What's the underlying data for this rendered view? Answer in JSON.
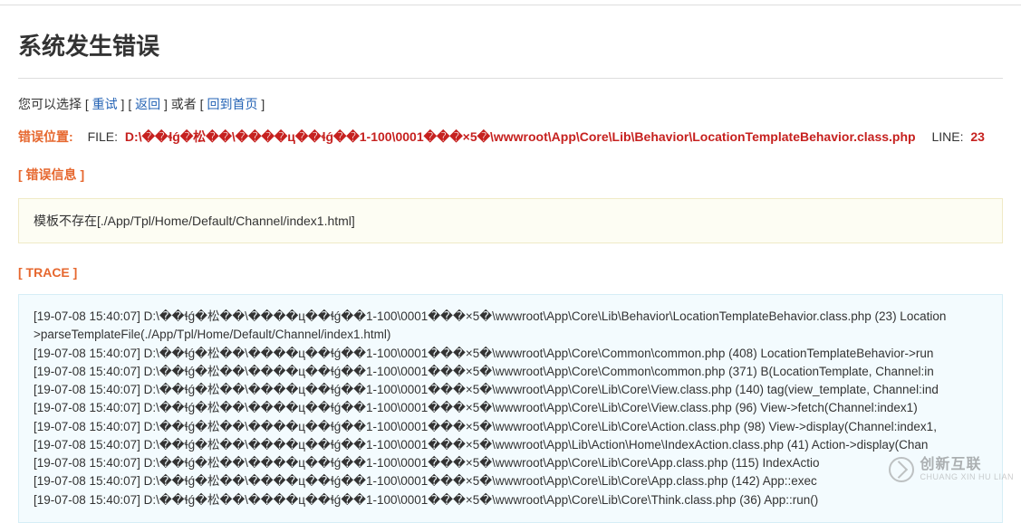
{
  "page_title": "系统发生错误",
  "options": {
    "prefix": "您可以选择",
    "retry_label": "重试",
    "back_label": "返回",
    "or_text": "或者",
    "home_label": "回到首页"
  },
  "error_location": {
    "label": "错误位置:",
    "file_label": "FILE:",
    "file_path": "D:\\��ɬǵ�松��\\����ц��ɬǵ��1-100\\0001���×5�\\wwwroot\\App\\Core\\Lib\\Behavior\\LocationTemplateBehavior.class.php",
    "line_label": "LINE:",
    "line_number": "23"
  },
  "error_info": {
    "header": "[ 错误信息 ]",
    "message": "模板不存在[./App/Tpl/Home/Default/Channel/index1.html]"
  },
  "trace": {
    "header": "[ TRACE ]",
    "lines": [
      "[19-07-08 15:40:07] D:\\��ɬǵ�松��\\����ц��ɬǵ��1-100\\0001���×5�\\wwwroot\\App\\Core\\Lib\\Behavior\\LocationTemplateBehavior.class.php (23) Location",
      ">parseTemplateFile(./App/Tpl/Home/Default/Channel/index1.html)",
      "[19-07-08 15:40:07] D:\\��ɬǵ�松��\\����ц��ɬǵ��1-100\\0001���×5�\\wwwroot\\App\\Core\\Common\\common.php (408) LocationTemplateBehavior->run",
      "[19-07-08 15:40:07] D:\\��ɬǵ�松��\\����ц��ɬǵ��1-100\\0001���×5�\\wwwroot\\App\\Core\\Common\\common.php (371) B(LocationTemplate, Channel:in",
      "[19-07-08 15:40:07] D:\\��ɬǵ�松��\\����ц��ɬǵ��1-100\\0001���×5�\\wwwroot\\App\\Core\\Lib\\Core\\View.class.php (140) tag(view_template, Channel:ind",
      "[19-07-08 15:40:07] D:\\��ɬǵ�松��\\����ц��ɬǵ��1-100\\0001���×5�\\wwwroot\\App\\Core\\Lib\\Core\\View.class.php (96) View->fetch(Channel:index1)",
      "[19-07-08 15:40:07] D:\\��ɬǵ�松��\\����ц��ɬǵ��1-100\\0001���×5�\\wwwroot\\App\\Core\\Lib\\Core\\Action.class.php (98) View->display(Channel:index1,",
      "[19-07-08 15:40:07] D:\\��ɬǵ�松��\\����ц��ɬǵ��1-100\\0001���×5�\\wwwroot\\App\\Lib\\Action\\Home\\IndexAction.class.php (41) Action->display(Chan",
      "[19-07-08 15:40:07] D:\\��ɬǵ�松��\\����ц��ɬǵ��1-100\\0001���×5�\\wwwroot\\App\\Core\\Lib\\Core\\App.class.php (115) IndexActio",
      "[19-07-08 15:40:07] D:\\��ɬǵ�松��\\����ц��ɬǵ��1-100\\0001���×5�\\wwwroot\\App\\Core\\Lib\\Core\\App.class.php (142) App::exec",
      "[19-07-08 15:40:07] D:\\��ɬǵ�松��\\����ц��ɬǵ��1-100\\0001���×5�\\wwwroot\\App\\Core\\Lib\\Core\\Think.class.php (36) App::run()"
    ]
  },
  "watermark": {
    "main": "创新互联",
    "sub": "CHUANG XIN HU LIAN"
  }
}
